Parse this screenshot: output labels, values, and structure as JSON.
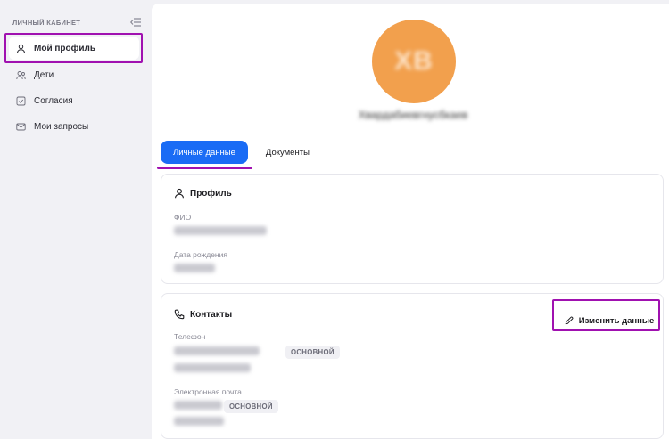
{
  "sidebar": {
    "title": "ЛИЧНЫЙ КАБИНЕТ",
    "collapse_icon": "collapse-menu-icon",
    "items": [
      {
        "label": "Мой профиль",
        "icon": "user-icon",
        "active": true
      },
      {
        "label": "Дети",
        "icon": "users-icon",
        "active": false
      },
      {
        "label": "Согласия",
        "icon": "checkbox-icon",
        "active": false
      },
      {
        "label": "Мои запросы",
        "icon": "mail-icon",
        "active": false
      }
    ]
  },
  "profile": {
    "avatar_initials": "ХВ",
    "avatar_color": "#f2a04d",
    "username": "Хвардабиевгнусбкаев"
  },
  "tabs": [
    {
      "label": "Личные данные",
      "active": true
    },
    {
      "label": "Документы",
      "active": false
    }
  ],
  "profile_card": {
    "title": "Профиль",
    "fields": [
      {
        "label": "ФИО"
      },
      {
        "label": "Дата рождения"
      }
    ]
  },
  "contacts_card": {
    "title": "Контакты",
    "edit_button": "Изменить данные",
    "phone_label": "Телефон",
    "email_label": "Электронная почта",
    "primary_badge": "ОСНОВНОЙ"
  },
  "colors": {
    "accent": "#1a6cf5",
    "highlight": "#a011b0",
    "avatar": "#f2a04d"
  }
}
